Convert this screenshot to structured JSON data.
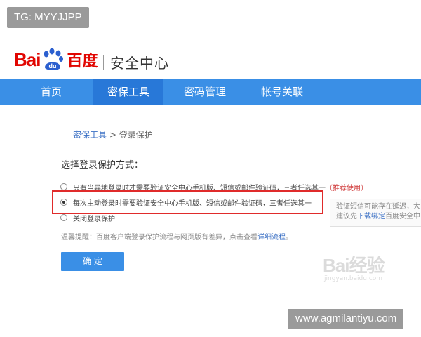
{
  "tag": "TG: MYYJJPP",
  "header": {
    "logo_bai": "Bai",
    "logo_du": "du",
    "logo_cn": "百度",
    "product": "安全中心"
  },
  "nav": {
    "items": [
      {
        "label": "首页",
        "active": false
      },
      {
        "label": "密保工具",
        "active": true
      },
      {
        "label": "密码管理",
        "active": false
      },
      {
        "label": "帐号关联",
        "active": false
      }
    ]
  },
  "breadcrumb": {
    "parent": "密保工具",
    "separator": ">",
    "current": "登录保护"
  },
  "section_title": "选择登录保护方式：",
  "options": [
    {
      "label": "只有当异地登录时才需要验证安全中心手机版、短信或邮件验证码，三者任选其一",
      "suffix": "（推荐使用）",
      "checked": false
    },
    {
      "label": "每次主动登录时需要验证安全中心手机版、短信或邮件验证码，三者任选其一",
      "suffix": "",
      "checked": true
    },
    {
      "label": "关闭登录保护",
      "suffix": "",
      "checked": false
    }
  ],
  "tooltip": {
    "line1": "验证短信可能存在延迟，大",
    "line2_prefix": "建议先",
    "line2_link": "下载绑定",
    "line2_suffix": "百度安全中"
  },
  "tip": {
    "text": "温馨提醒：百度客户端登录保护流程与网页版有差异，点击查看",
    "link": "详细流程",
    "end": "。"
  },
  "confirm_button": "确 定",
  "watermark": {
    "text": "Bai经验",
    "url": "jingyan.baidu.com"
  },
  "url_tag": "www.agmilantiyu.com",
  "colors": {
    "brand_red": "#e10601",
    "nav_blue": "#3a8fe6",
    "nav_active": "#2878d8",
    "highlight_red": "#e02b2b",
    "link_blue": "#3a6fc4"
  }
}
